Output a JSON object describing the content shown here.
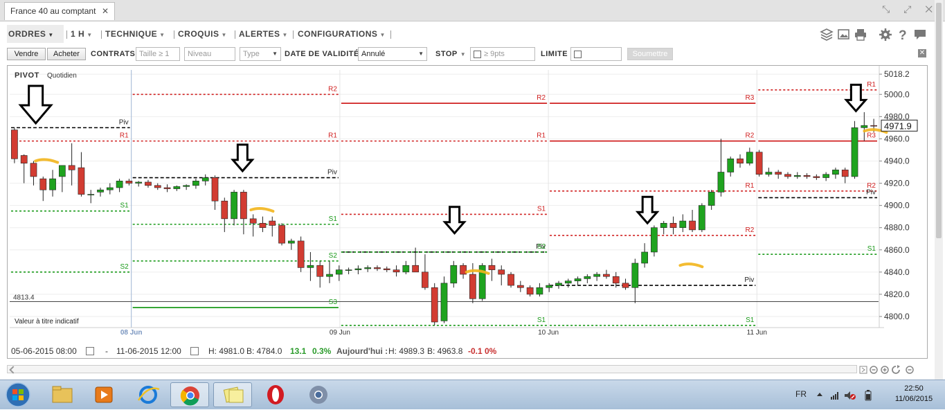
{
  "window": {
    "tab_title": "France 40 au comptant",
    "tab_close": "✕",
    "controls": [
      "⤡",
      "⤢",
      "✕"
    ]
  },
  "menu": {
    "ordres": "ORDRES",
    "interval": "1 H",
    "technique": "TECHNIQUE",
    "croquis": "CROQUIS",
    "alertes": "ALERTES",
    "configurations": "CONFIGURATIONS"
  },
  "order_bar": {
    "sell": "Vendre",
    "buy": "Acheter",
    "contrats_label": "CONTRATS",
    "size_placeholder": "Taille ≥ 1",
    "level_placeholder": "Niveau",
    "type_placeholder": "Type",
    "validity_label": "DATE DE VALIDITÉ",
    "validity_value": "Annulé",
    "stop_label": "STOP",
    "stop_placeholder": "≥ 9pts",
    "limit_label": "LIMITE",
    "submit": "Soumettre"
  },
  "chart_data": {
    "type": "candlestick",
    "indicator": "PIVOT",
    "indicator_period": "Quotidien",
    "note": "Valeur à titre indicatif",
    "current_price": "4971.9",
    "reference_price": "4813.4",
    "y_ticks": [
      "5018.2",
      "5000.0",
      "4980.0",
      "4960.0",
      "4940.0",
      "4920.0",
      "4900.0",
      "4880.0",
      "4860.0",
      "4840.0",
      "4820.0",
      "4800.0"
    ],
    "y_tick_values": [
      5018.2,
      5000,
      4980,
      4960,
      4940,
      4920,
      4900,
      4880,
      4860,
      4840,
      4820,
      4800
    ],
    "ylim": [
      4790,
      5022
    ],
    "x_labels": [
      "08 Jun",
      "09 Jun",
      "10 Jun",
      "11 Jun"
    ],
    "x_label_index": [
      7,
      19,
      31,
      43
    ],
    "n_slots": 50,
    "candles": [
      [
        4968,
        4970,
        4938,
        4942
      ],
      [
        4945,
        4946,
        4920,
        4938
      ],
      [
        4938,
        4940,
        4918,
        4926
      ],
      [
        4924,
        4926,
        4904,
        4914
      ],
      [
        4914,
        4932,
        4908,
        4924
      ],
      [
        4926,
        4936,
        4912,
        4936
      ],
      [
        4936,
        4956,
        4918,
        4932
      ],
      [
        4934,
        4948,
        4908,
        4910
      ],
      [
        4910,
        4914,
        4902,
        4910
      ],
      [
        4912,
        4916,
        4908,
        4914
      ],
      [
        4914,
        4920,
        4910,
        4916
      ],
      [
        4916,
        4924,
        4912,
        4922
      ],
      [
        4922,
        4924,
        4918,
        4920
      ],
      [
        4920,
        4922,
        4917,
        4921
      ],
      [
        4921,
        4923,
        4916,
        4918
      ],
      [
        4918,
        4920,
        4914,
        4916
      ],
      [
        4916,
        4919,
        4912,
        4915
      ],
      [
        4915,
        4918,
        4913,
        4917
      ],
      [
        4917,
        4919,
        4914,
        4918
      ],
      [
        4918,
        4924,
        4915,
        4922
      ],
      [
        4922,
        4928,
        4918,
        4925
      ],
      [
        4925,
        4927,
        4896,
        4904
      ],
      [
        4904,
        4907,
        4876,
        4888
      ],
      [
        4888,
        4914,
        4882,
        4912
      ],
      [
        4912,
        4914,
        4874,
        4888
      ],
      [
        4888,
        4892,
        4872,
        4884
      ],
      [
        4884,
        4890,
        4876,
        4880
      ],
      [
        4886,
        4890,
        4872,
        4882
      ],
      [
        4882,
        4884,
        4864,
        4866
      ],
      [
        4866,
        4870,
        4860,
        4868
      ],
      [
        4868,
        4872,
        4840,
        4844
      ],
      [
        4844,
        4858,
        4832,
        4846
      ],
      [
        4846,
        4850,
        4826,
        4836
      ],
      [
        4836,
        4850,
        4830,
        4838
      ],
      [
        4838,
        4846,
        4832,
        4842
      ],
      [
        4842,
        4844,
        4838,
        4842
      ],
      [
        4842,
        4846,
        4838,
        4843
      ],
      [
        4843,
        4846,
        4840,
        4844
      ],
      [
        4844,
        4846,
        4841,
        4843
      ],
      [
        4843,
        4845,
        4840,
        4842
      ],
      [
        4842,
        4846,
        4836,
        4840
      ],
      [
        4840,
        4850,
        4838,
        4846
      ],
      [
        4846,
        4862,
        4840,
        4840
      ],
      [
        4840,
        4856,
        4824,
        4826
      ],
      [
        4826,
        4830,
        4792,
        4795
      ],
      [
        4796,
        4836,
        4794,
        4830
      ],
      [
        4830,
        4850,
        4826,
        4846
      ],
      [
        4846,
        4848,
        4834,
        4838
      ],
      [
        4838,
        4848,
        4812,
        4816
      ],
      [
        4816,
        4848,
        4814,
        4846
      ],
      [
        4846,
        4852,
        4832,
        4842
      ],
      [
        4842,
        4846,
        4828,
        4838
      ],
      [
        4838,
        4840,
        4826,
        4828
      ],
      [
        4828,
        4832,
        4822,
        4826
      ],
      [
        4826,
        4828,
        4818,
        4820
      ],
      [
        4820,
        4830,
        4818,
        4826
      ],
      [
        4826,
        4830,
        4822,
        4828
      ],
      [
        4828,
        4832,
        4825,
        4830
      ],
      [
        4830,
        4834,
        4826,
        4832
      ],
      [
        4832,
        4836,
        4828,
        4834
      ],
      [
        4834,
        4838,
        4830,
        4836
      ],
      [
        4836,
        4840,
        4832,
        4838
      ],
      [
        4838,
        4842,
        4834,
        4836
      ],
      [
        4836,
        4840,
        4826,
        4830
      ],
      [
        4830,
        4834,
        4824,
        4826
      ],
      [
        4826,
        4852,
        4812,
        4848
      ],
      [
        4848,
        4866,
        4844,
        4858
      ],
      [
        4858,
        4882,
        4854,
        4880
      ],
      [
        4880,
        4886,
        4874,
        4884
      ],
      [
        4884,
        4890,
        4874,
        4880
      ],
      [
        4880,
        4892,
        4876,
        4886
      ],
      [
        4886,
        4896,
        4876,
        4878
      ],
      [
        4878,
        4902,
        4876,
        4900
      ],
      [
        4900,
        4914,
        4896,
        4912
      ],
      [
        4912,
        4960,
        4908,
        4930
      ],
      [
        4930,
        4944,
        4926,
        4942
      ],
      [
        4942,
        4946,
        4934,
        4938
      ],
      [
        4938,
        4952,
        4936,
        4948
      ],
      [
        4948,
        4950,
        4926,
        4928
      ],
      [
        4928,
        4934,
        4926,
        4930
      ],
      [
        4930,
        4932,
        4924,
        4928
      ],
      [
        4928,
        4930,
        4924,
        4926
      ],
      [
        4926,
        4930,
        4924,
        4927
      ],
      [
        4927,
        4929,
        4924,
        4926
      ],
      [
        4926,
        4928,
        4923,
        4925
      ],
      [
        4925,
        4930,
        4922,
        4928
      ],
      [
        4928,
        4934,
        4924,
        4932
      ],
      [
        4932,
        4934,
        4920,
        4926
      ],
      [
        4926,
        4976,
        4924,
        4970
      ],
      [
        4970,
        4984,
        4958,
        4972
      ],
      [
        4972,
        4978,
        4966,
        4971.9
      ]
    ],
    "pivot_levels": [
      {
        "name": "Piv",
        "start": 0,
        "end": 7,
        "value": 4970,
        "color": "#000000",
        "dash": true
      },
      {
        "name": "R1",
        "start": 0,
        "end": 7,
        "value": 4958,
        "color": "#d02020",
        "dash": true
      },
      {
        "name": "S1",
        "start": 0,
        "end": 7,
        "value": 4895,
        "color": "#1a9a1a",
        "dash": true
      },
      {
        "name": "S2",
        "start": 0,
        "end": 7,
        "value": 4840,
        "color": "#1a9a1a",
        "dash": true
      },
      {
        "name": "R2",
        "start": 7,
        "end": 19,
        "value": 5000,
        "color": "#d02020",
        "dash": true
      },
      {
        "name": "R1",
        "start": 7,
        "end": 19,
        "value": 4958,
        "color": "#d02020",
        "dash": true
      },
      {
        "name": "Piv",
        "start": 7,
        "end": 19,
        "value": 4925,
        "color": "#000000",
        "dash": true
      },
      {
        "name": "S1",
        "start": 7,
        "end": 19,
        "value": 4883,
        "color": "#1a9a1a",
        "dash": true
      },
      {
        "name": "S2",
        "start": 7,
        "end": 19,
        "value": 4850,
        "color": "#1a9a1a",
        "dash": true
      },
      {
        "name": "S3",
        "start": 7,
        "end": 19,
        "value": 4808,
        "color": "#1a9a1a",
        "dash": false
      },
      {
        "name": "R2",
        "start": 19,
        "end": 31,
        "value": 4992,
        "color": "#d02020",
        "dash": false
      },
      {
        "name": "R1",
        "start": 19,
        "end": 31,
        "value": 4958,
        "color": "#d02020",
        "dash": true
      },
      {
        "name": "Piv",
        "start": 19,
        "end": 31,
        "value": 4858,
        "color": "#000000",
        "dash": true
      },
      {
        "name": "S1",
        "start": 19,
        "end": 31,
        "value": 4892,
        "color": "#d02020",
        "dash": true
      },
      {
        "name": "S2",
        "start": 19,
        "end": 31,
        "value": 4858,
        "color": "#1a9a1a",
        "dash": true
      },
      {
        "name": "S1",
        "start": 19,
        "end": 31,
        "value": 4792,
        "color": "#1a9a1a",
        "dash": true
      },
      {
        "name": "R3",
        "start": 31,
        "end": 43,
        "value": 4992,
        "color": "#d02020",
        "dash": false
      },
      {
        "name": "R2",
        "start": 31,
        "end": 43,
        "value": 4958,
        "color": "#d02020",
        "dash": false
      },
      {
        "name": "R1",
        "start": 31,
        "end": 43,
        "value": 4913,
        "color": "#d02020",
        "dash": true
      },
      {
        "name": "Piv",
        "start": 31,
        "end": 43,
        "value": 4828,
        "color": "#000000",
        "dash": true
      },
      {
        "name": "R2",
        "start": 31,
        "end": 43,
        "value": 4873,
        "color": "#d02020",
        "dash": true
      },
      {
        "name": "S1",
        "start": 31,
        "end": 43,
        "value": 4792,
        "color": "#1a9a1a",
        "dash": true
      },
      {
        "name": "R1",
        "start": 43,
        "end": 50,
        "value": 5004,
        "color": "#d02020",
        "dash": true
      },
      {
        "name": "R3",
        "start": 43,
        "end": 50,
        "value": 4958,
        "color": "#d02020",
        "dash": false
      },
      {
        "name": "R2",
        "start": 43,
        "end": 50,
        "value": 4913,
        "color": "#d02020",
        "dash": true
      },
      {
        "name": "Piv",
        "start": 43,
        "end": 50,
        "value": 4907,
        "color": "#000000",
        "dash": true
      },
      {
        "name": "S1",
        "start": 43,
        "end": 50,
        "value": 4856,
        "color": "#1a9a1a",
        "dash": true
      }
    ],
    "arrows": [
      {
        "slot": 1.5,
        "price": 4974
      },
      {
        "slot": 13.4,
        "price": 4931
      },
      {
        "slot": 25.6,
        "price": 4875
      },
      {
        "slot": 36.7,
        "price": 4884
      },
      {
        "slot": 48.7,
        "price": 4985
      }
    ],
    "highlights": [
      {
        "slot": 1.8,
        "price": 4940
      },
      {
        "slot": 14.2,
        "price": 4896
      },
      {
        "slot": 26.6,
        "price": 4840
      },
      {
        "slot": 38.9,
        "price": 4846
      },
      {
        "slot": 49.5,
        "price": 4967
      }
    ]
  },
  "info": {
    "start_date": "05-06-2015 08:00",
    "dash": "-",
    "end_date": "11-06-2015 12:00",
    "high": "H: 4981.0",
    "low": "B: 4784.0",
    "change": "13.1",
    "change_pct": "0.3%",
    "today_label": "Aujourd'hui :",
    "today_high": "H: 4989.3",
    "today_low": "B: 4963.8",
    "today_change": "-0.1",
    "today_pct": "0%"
  },
  "taskbar": {
    "lang": "FR",
    "time": "22:50",
    "date": "11/06/2015"
  }
}
